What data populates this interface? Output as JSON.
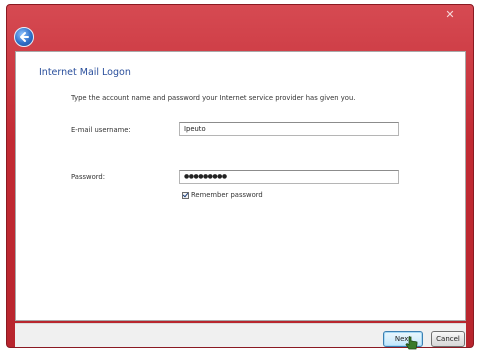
{
  "window": {
    "close_label": "✕",
    "accent_color": "#c8303a"
  },
  "page": {
    "heading": "Internet Mail Logon",
    "instructions": "Type the account name and password your Internet service provider has given you."
  },
  "form": {
    "username_label": "E-mail username:",
    "username_value": "Ipeuto",
    "password_label": "Password:",
    "password_value": "●●●●●●●●●",
    "remember_label": "Remember password",
    "remember_checked": true
  },
  "footer": {
    "next_label": "Next",
    "cancel_label": "Cancel"
  },
  "icons": {
    "back": "back-arrow-icon",
    "cursor": "hand-pointer-icon"
  }
}
